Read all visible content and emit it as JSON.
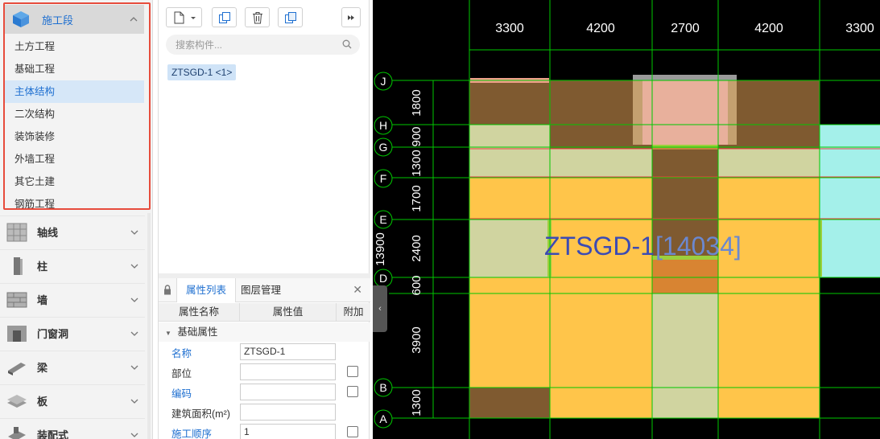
{
  "nav": {
    "group_title": "施工段",
    "sub_items": [
      "土方工程",
      "基础工程",
      "主体结构",
      "二次结构",
      "装饰装修",
      "外墙工程",
      "其它土建",
      "钢筋工程"
    ],
    "active_sub": "主体结构",
    "categories": [
      {
        "label": "轴线",
        "icon": "grid-icon"
      },
      {
        "label": "柱",
        "icon": "column-icon"
      },
      {
        "label": "墙",
        "icon": "wall-icon"
      },
      {
        "label": "门窗洞",
        "icon": "door-window-icon"
      },
      {
        "label": "梁",
        "icon": "beam-icon"
      },
      {
        "label": "板",
        "icon": "slab-icon"
      },
      {
        "label": "装配式",
        "icon": "prefab-icon"
      }
    ]
  },
  "component_list": {
    "search_placeholder": "搜索构件...",
    "items": [
      "ZTSGD-1 <1>"
    ]
  },
  "properties": {
    "tabs": [
      "属性列表",
      "图层管理"
    ],
    "headers": [
      "属性名称",
      "属性值",
      "附加"
    ],
    "section": "基础属性",
    "rows": [
      {
        "name": "名称",
        "value": "ZTSGD-1",
        "blue": true,
        "check": false
      },
      {
        "name": "部位",
        "value": "",
        "blue": false,
        "check": true
      },
      {
        "name": "编码",
        "value": "",
        "blue": true,
        "check": true
      },
      {
        "name": "建筑面积(m²)",
        "value": "",
        "blue": false,
        "check": false
      },
      {
        "name": "施工顺序",
        "value": "1",
        "blue": true,
        "check": true
      }
    ]
  },
  "canvas": {
    "top_dims": [
      "3300",
      "4200",
      "2700",
      "4200",
      "3300"
    ],
    "axes": [
      "J",
      "H",
      "G",
      "F",
      "E",
      "D",
      "B",
      "A"
    ],
    "side_dims": [
      "1800",
      "900",
      "1300",
      "1700",
      "2400",
      "600",
      "3900",
      "1300"
    ],
    "total_dim": "13900",
    "label_name": "ZTSGD-1",
    "label_area": "[14034]",
    "colors": {
      "accent": "#1e6fd0",
      "grid": "#00c800",
      "orange": "#ffc54a",
      "brown": "#7f5a30",
      "sage": "#d0d4a0",
      "cyan": "#a4f0ea"
    }
  }
}
